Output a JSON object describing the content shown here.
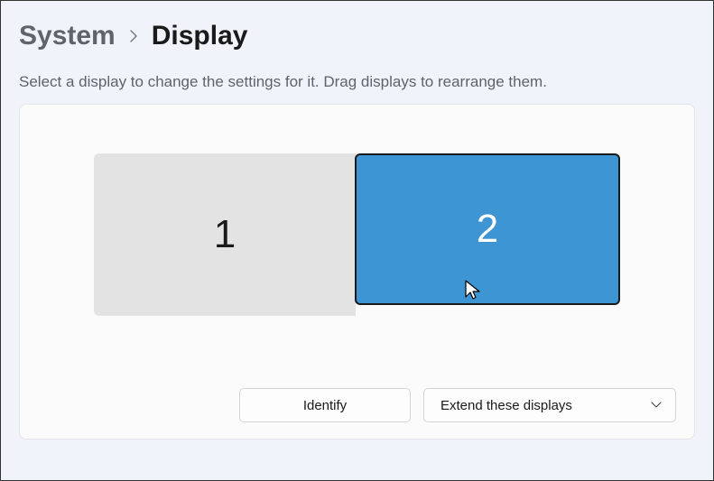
{
  "breadcrumb": {
    "parent": "System",
    "current": "Display"
  },
  "description": "Select a display to change the settings for it. Drag displays to rearrange them.",
  "monitors": {
    "m1": "1",
    "m2": "2"
  },
  "actions": {
    "identify": "Identify",
    "mode_dropdown": "Extend these displays"
  }
}
